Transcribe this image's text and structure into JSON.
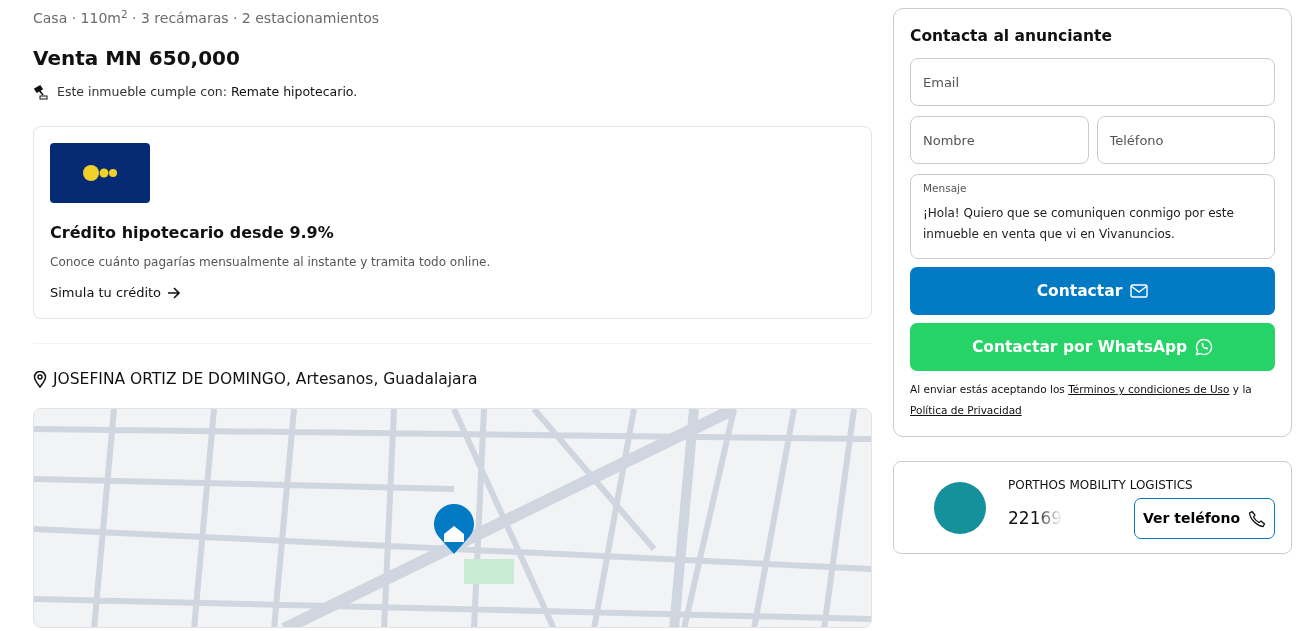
{
  "listing": {
    "features": "Casa · 110m$^{2}$ · 3 recámaras · 2 estacionamientos",
    "price": "Venta MN 650,000",
    "compliance_text": "Este inmueble cumple con:",
    "compliance_value": "Remate hipotecario."
  },
  "credit_card": {
    "title": "Crédito hipotecario desde 9.9%",
    "description": "Conoce cuánto pagarías mensualmente al instante y tramita todo online.",
    "link": "Simula tu crédito"
  },
  "location": {
    "address": "JOSEFINA ORTIZ DE DOMINGO, Artesanos, Guadalajara"
  },
  "contact_form": {
    "title": "Contacta al anunciante",
    "fields": [
      {
        "kind": "input",
        "placeholder": "Email"
      },
      {
        "kind": "input",
        "placeholder": "Nombre"
      },
      {
        "kind": "input",
        "placeholder": "Teléfono"
      },
      {
        "kind": "textarea",
        "label": "Mensaje",
        "value": "¡Hola! Quiero que se comuniquen conmigo por este inmueble en venta que vi en Vivanuncios."
      }
    ],
    "contact_button": "Contactar",
    "whatsapp_button": "Contactar por WhatsApp",
    "legal_prefix": "Al enviar estás aceptando los",
    "terms_link": "Términos y condiciones de Uso",
    "legal_middle": "y la",
    "privacy_link": "Política de Privacidad"
  },
  "advertiser": {
    "name": "PORTHOS MOBILITY LOGISTICS",
    "phone_partial": "22169",
    "phone_button": "Ver teléfono"
  }
}
